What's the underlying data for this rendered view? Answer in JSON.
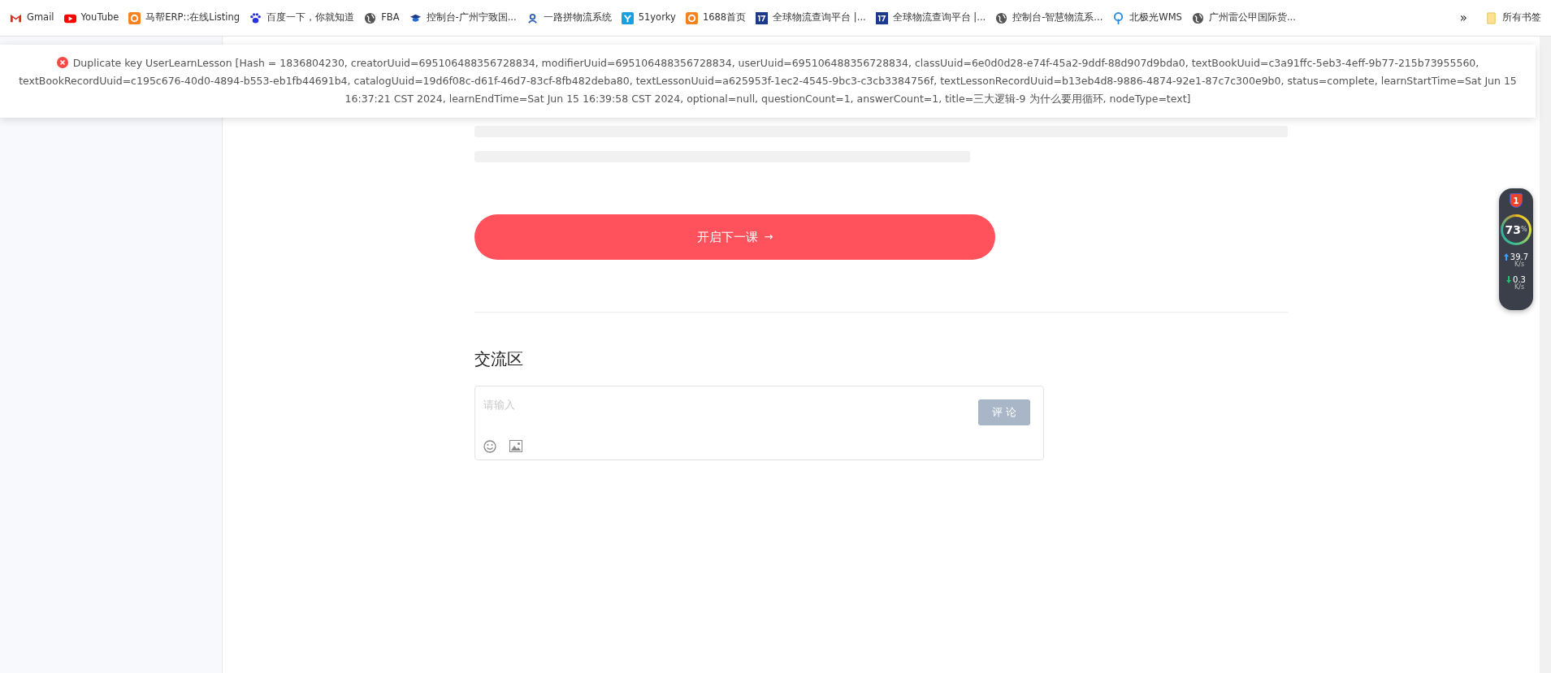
{
  "bookmarks": [
    {
      "label": "Gmail",
      "kind": "mail"
    },
    {
      "label": "YouTube",
      "kind": "play"
    },
    {
      "label": "马帮ERP::在线Listing",
      "kind": "orange"
    },
    {
      "label": "百度一下，你就知道",
      "kind": "paw"
    },
    {
      "label": "FBA",
      "kind": "globe"
    },
    {
      "label": "控制台-广州宁致国...",
      "kind": "cap"
    },
    {
      "label": "一路拼物流系统",
      "kind": "figure"
    },
    {
      "label": "51yorky",
      "kind": "blue"
    },
    {
      "label": "1688首页",
      "kind": "orange"
    },
    {
      "label": "全球物流查询平台 |...",
      "kind": "navy"
    },
    {
      "label": "全球物流查询平台 |...",
      "kind": "navy"
    },
    {
      "label": "控制台-智慧物流系...",
      "kind": "globe"
    },
    {
      "label": "北极光WMS",
      "kind": "pin"
    },
    {
      "label": "广州雷公甲国际货...",
      "kind": "globe"
    }
  ],
  "bookmarks_more": "»",
  "all_bookmarks": "所有书签",
  "toast": {
    "kind": "error",
    "message": "Duplicate key UserLearnLesson [Hash = 1836804230, creatorUuid=695106488356728834, modifierUuid=695106488356728834, userUuid=695106488356728834, classUuid=6e0d0d28-e74f-45a2-9ddf-88d907d9bda0, textBookUuid=c3a91ffc-5eb3-4eff-9b77-215b73955560, textBookRecordUuid=c195c676-40d0-4894-b553-eb1fb44691b4, catalogUuid=19d6f08c-d61f-46d7-83cf-8fb482deba80, textLessonUuid=a625953f-1ec2-4545-9bc3-c3cb3384756f, textLessonRecordUuid=b13eb4d8-9886-4874-92e1-87c7c300e9b0, status=complete, learnStartTime=Sat Jun 15 16:37:21 CST 2024, learnEndTime=Sat Jun 15 16:39:58 CST 2024, optional=null, questionCount=1, answerCount=1, title=三大逻辑-9 为什么要用循环, nodeType=text]"
  },
  "next_button": {
    "label": "开启下一课",
    "arrow": "→"
  },
  "comments": {
    "title": "交流区",
    "placeholder": "请输入",
    "submit": "评 论",
    "submit_disabled": true
  },
  "monitor": {
    "alerts": "1",
    "percent": "73",
    "percent_unit": "%",
    "upload": "39.7",
    "upload_unit": "K/s",
    "download": "0.3",
    "download_unit": "K/s"
  }
}
